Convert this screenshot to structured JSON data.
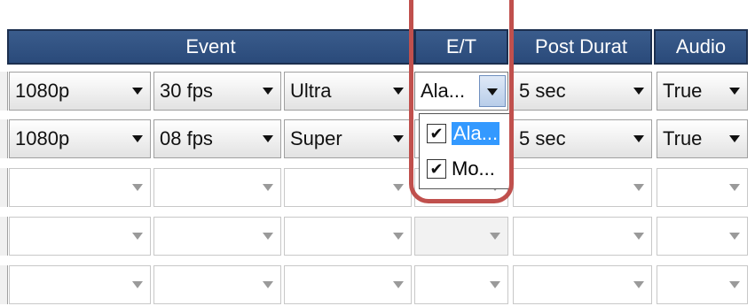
{
  "headers": {
    "event": "Event",
    "et": "E/T",
    "post_duration": "Post  Durat",
    "audio": "Audio"
  },
  "rows": [
    {
      "resolution": "1080p",
      "fps": "30 fps",
      "quality": "Ultra",
      "et": "Ala...",
      "post": "5 sec",
      "audio": "True"
    },
    {
      "resolution": "1080p",
      "fps": "08 fps",
      "quality": "Super",
      "et": "",
      "post": "5 sec",
      "audio": "True"
    }
  ],
  "et_dropdown": {
    "items": [
      {
        "label": "Ala...",
        "checked": true,
        "selected": true
      },
      {
        "label": "Mo...",
        "checked": true,
        "selected": false
      }
    ]
  },
  "colors": {
    "header": "#2f4f80",
    "highlight": "#c0504d",
    "selection": "#3399ff"
  }
}
